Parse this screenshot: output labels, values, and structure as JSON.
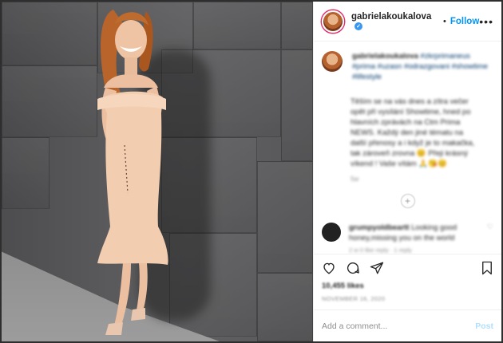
{
  "header": {
    "username": "gabrielakoukalova",
    "separator": "•",
    "follow_label": "Follow",
    "more_label": "•••"
  },
  "caption": {
    "username": "gabrielakoukalova",
    "hashtags": "#zkrprimaneus #prima #uzasn #odrazgovani #showtime #lifestyle",
    "body": "Těším se na vás dnes a zítra večer opět při vysílání Showtime, hned po hlavních zprávách na Ctm Prima NEWS. Každý den jiné tématu na další přenosy a i když je to makačka, tak zároveň zrovna 😊 Přeji krásný víkend ! Vaše vítám 🙏😘😊",
    "time": "5w",
    "load_more": "+"
  },
  "comment": {
    "username": "grumpyoldbeartt",
    "text": "Looking good honey,missing you on the world",
    "meta": "2 w  0 like  reply  ·  1 reply",
    "like_icon": "♡"
  },
  "actions": {
    "likes": "10,455 likes",
    "date": "NOVEMBER 16, 2020"
  },
  "add_comment": {
    "placeholder": "Add a comment...",
    "post_label": "Post"
  },
  "colors": {
    "accent": "#0095f6",
    "post_disabled": "#b2dffc",
    "verified": "#3897f0"
  }
}
